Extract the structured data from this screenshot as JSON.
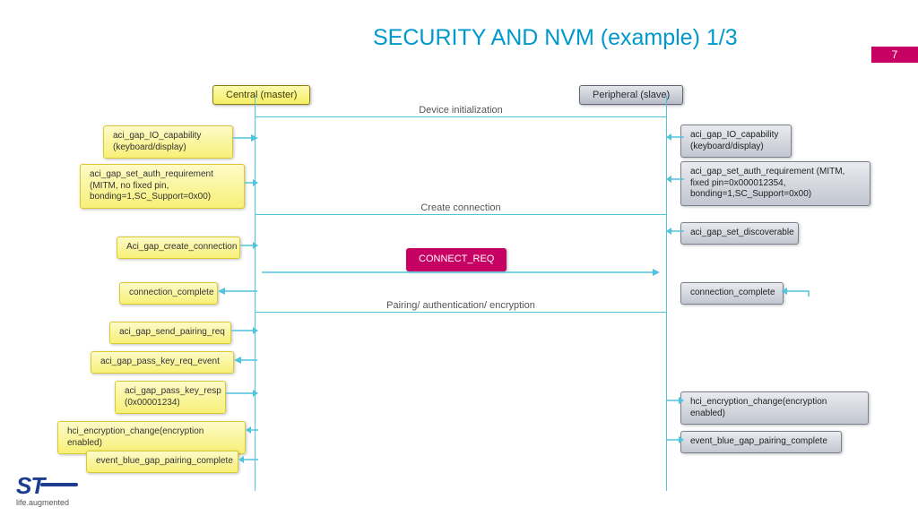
{
  "page_number": "7",
  "title": "SECURITY AND NVM (example) 1/3",
  "lifelines": {
    "central": "Central (master)",
    "peripheral": "Peripheral (slave)"
  },
  "sections": {
    "init": "Device initialization",
    "connect": "Create connection",
    "pair": "Pairing/ authentication/ encryption"
  },
  "connect_msg": "CONNECT_REQ",
  "central_boxes": {
    "io": "aci_gap_IO_capability (keyboard/display)",
    "auth": "aci_gap_set_auth_requirement (MITM, no fixed pin, bonding=1,SC_Support=0x00)",
    "create": "Aci_gap_create_connection",
    "cc": "connection_complete",
    "send_pair": "aci_gap_send_pairing_req",
    "pk_evt": "aci_gap_pass_key_req_event",
    "pk_resp": "aci_gap_pass_key_resp (0x00001234)",
    "enc": "hci_encryption_change(encryption enabled)",
    "pc": "event_blue_gap_pairing_complete"
  },
  "periph_boxes": {
    "io": "aci_gap_IO_capability (keyboard/display)",
    "auth": "aci_gap_set_auth_requirement (MITM, fixed pin=0x000012354, bonding=1,SC_Support=0x00)",
    "disc": "aci_gap_set_discoverable",
    "cc": "connection_complete",
    "enc": "hci_encryption_change(encryption enabled)",
    "pc": "event_blue_gap_pairing_complete"
  },
  "logo": {
    "mark": "ST",
    "sub": "life.augmented"
  }
}
